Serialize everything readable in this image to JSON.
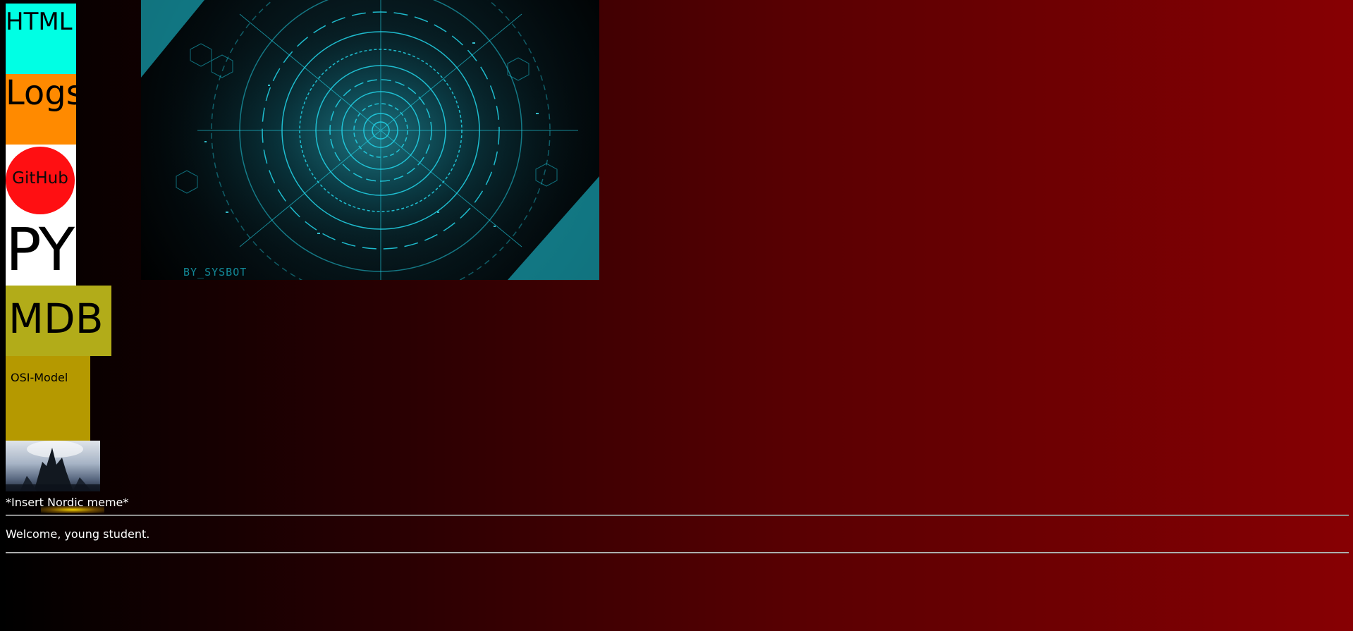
{
  "nav": {
    "html": {
      "label": "HTML",
      "color": "#00ffe4"
    },
    "logs": {
      "label": "Logs",
      "color": "#ff8a00"
    },
    "github": {
      "label": "GitHub",
      "color": "#ff0f12"
    },
    "py": {
      "label": "PY",
      "color": "#ffffff"
    },
    "mdb": {
      "label": "MDB",
      "color": "#b2ac19"
    },
    "osi": {
      "label": "OSI-Model",
      "color": "#b59900"
    }
  },
  "hero": {
    "watermark": "BY_SYSBOT"
  },
  "nordic": {
    "caption": "*Insert Nordic meme*"
  },
  "content": {
    "welcome": "Welcome, young student."
  },
  "colors": {
    "background_start": "#000000",
    "background_end": "#870003",
    "hero_accent": "#1fd2e6"
  }
}
